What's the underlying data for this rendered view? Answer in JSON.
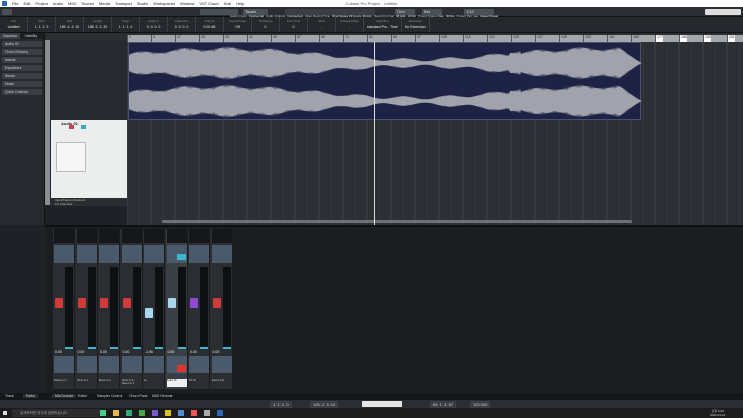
{
  "window": {
    "title": "Cubase Pro Project - Untitled"
  },
  "menu": [
    "File",
    "Edit",
    "Project",
    "Audio",
    "MIDI",
    "Scores",
    "Media",
    "Transport",
    "Studio",
    "Workspaces",
    "Window",
    "VST Cloud",
    "Hub",
    "Help"
  ],
  "toolbar": {
    "mode": "Touch",
    "snap": "Grid",
    "grid_type": "Bar",
    "quantize": "1/16",
    "right_labels": [
      "Audio Inputs",
      "Connected",
      "Audio Outputs",
      "Connected",
      "Video Record Time",
      "Disk Space 29 hours 16 min",
      "Record Format",
      "48 kHz - 24 bit",
      "Project Frame Rate",
      "30 fps",
      "Project Pan Law",
      "Equal Power"
    ]
  },
  "info_line": [
    {
      "label": "File",
      "value": "Untitled"
    },
    {
      "label": "Start",
      "value": "1. 1. 1. 0"
    },
    {
      "label": "End",
      "value": "189. 4. 3. 20"
    },
    {
      "label": "Length",
      "value": "188. 3. 2. 20"
    },
    {
      "label": "Snap",
      "value": "1. 1. 1. 0"
    },
    {
      "label": "Fade-In",
      "value": "0. 0. 0. 0"
    },
    {
      "label": "Fade-Out",
      "value": "0. 0. 0. 0"
    },
    {
      "label": "Volume",
      "value": "0.00 dB"
    },
    {
      "label": "Invert Phase",
      "value": "Off"
    },
    {
      "label": "Transpose",
      "value": "0"
    },
    {
      "label": "Fine-Tune",
      "value": "0"
    },
    {
      "label": "Mute",
      "value": "-"
    },
    {
      "label": "Musical Mode",
      "value": "-"
    },
    {
      "label": "Algorithm",
      "value": "standard Pro - Time"
    },
    {
      "label": "Extension",
      "value": "No Extension"
    }
  ],
  "inspector": {
    "tabs": [
      "Inspector",
      "Visibility"
    ],
    "sections": [
      "Audio 01",
      "Chord Delivery",
      "Inserts",
      "Equalizers",
      "Sends",
      "Notes",
      "Quick Controls"
    ]
  },
  "tracks": [
    {
      "name": "Audio 01"
    }
  ],
  "tracklist_footer": [
    "Input/Output Channels",
    "FX Channels"
  ],
  "ruler": [
    "1",
    "9",
    "17",
    "25",
    "33",
    "41",
    "49",
    "57",
    "65",
    "73",
    "81",
    "89",
    "97",
    "105",
    "113",
    "121",
    "129",
    "137",
    "145",
    "153",
    "161",
    "169",
    "177",
    "185",
    "193",
    "201"
  ],
  "mixer": {
    "channels": [
      {
        "name": "Stereo In 1",
        "value": "0.00",
        "color": "#d23a3a",
        "level": 0.62
      },
      {
        "name": "Mono In 1",
        "value": "0.00",
        "color": "#d23a3a",
        "level": 0.62
      },
      {
        "name": "Mono In 2",
        "value": "0.00",
        "color": "#d23a3a",
        "level": 0.62
      },
      {
        "name": "Mono In 3 / Stereo In 2",
        "value": "0.00",
        "color": "#d23a3a",
        "level": 0.62
      },
      {
        "name": "ex",
        "value": "-1.90",
        "color": "#a8d6ee",
        "level": 0.5
      },
      {
        "name": "Audio 01",
        "value": "0.00",
        "color": "#a8d6ee",
        "level": 0.62
      },
      {
        "name": "FX 01",
        "value": "0.00",
        "color": "#8c4ad6",
        "level": 0.62
      },
      {
        "name": "Stereo Out",
        "value": "0.00",
        "color": "#d23a3a",
        "level": 0.62
      }
    ]
  },
  "lower_tabs": [
    "Track",
    "Editor",
    "MixConsole",
    "Editor",
    "Sampler Control",
    "Chord Pads",
    "MIDI Remote"
  ],
  "transport": {
    "left_locator": "1. 1. 1. 0",
    "right_locator": "126. 2. 3. 10",
    "position": "65. 1. 3. 67",
    "tempo": "120.000"
  },
  "taskbar": {
    "search_placeholder": "검색하려면 여기에 입력하십시오.",
    "time": "오후 6:26",
    "date": "2022-01-10"
  }
}
